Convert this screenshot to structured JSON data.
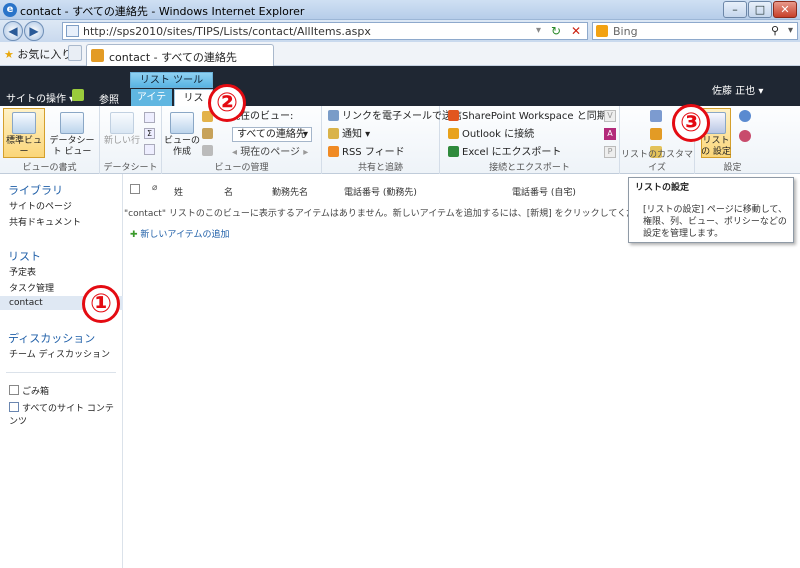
{
  "browser": {
    "title": "contact - すべての連絡先 - Windows Internet Explorer",
    "address": "http://sps2010/sites/TIPS/Lists/contact/AllItems.aspx",
    "search_engine": "Bing",
    "favorites_label": "お気に入り",
    "tab_label": "contact - すべての連絡先"
  },
  "sp": {
    "site_actions": "サイトの操作",
    "browse_tab": "参照",
    "context_group": "リスト ツール",
    "tab_items": "アイテム",
    "tab_list": "リスト",
    "user": "佐藤 正也"
  },
  "ribbon": {
    "standard_view": "標準ビュー",
    "datasheet_view": "データシート ビュー",
    "group_view_format": "ビューの書式",
    "new_row": "新しい行",
    "group_datasheet": "データシート",
    "create_view": "ビューの 作成",
    "current_view_label": "現在のビュー:",
    "current_view_value": "すべての連絡先",
    "current_page": "現在のページ",
    "group_manage_views": "ビューの管理",
    "email_link": "リンクを電子メールで送信",
    "alert_me": "通知",
    "rss_feed": "RSS フィード",
    "group_share_track": "共有と追跡",
    "sp_workspace": "SharePoint Workspace と同期",
    "connect_outlook": "Outlook に接続",
    "export_excel": "Excel にエクスポート",
    "group_connect_export": "接続とエクスポート",
    "group_customize": "リストのカスタマイズ",
    "list_settings": "リストの 設定",
    "group_settings": "設定"
  },
  "leftnav": {
    "libraries": "ライブラリ",
    "site_pages": "サイトのページ",
    "shared_docs": "共有ドキュメント",
    "lists": "リスト",
    "calendar": "予定表",
    "tasks": "タスク管理",
    "contact": "contact",
    "discussions": "ディスカッション",
    "team_discussion": "チーム ディスカッション",
    "recycle_bin": "ごみ箱",
    "all_content": "すべてのサイト コンテンツ"
  },
  "table": {
    "columns": [
      "姓",
      "名",
      "勤務先名",
      "電話番号 (勤務先)",
      "電話番号 (自宅)"
    ],
    "empty_message": "\"contact\" リストのこのビューに表示するアイテムはありません。新しいアイテムを追加するには、[新規] をクリックしてください。",
    "add_new": "新しいアイテムの追加"
  },
  "tooltip": {
    "title": "リストの設定",
    "body": "[リストの設定] ページに移動して、権限、列、ビュー、ポリシーなどの設定を管理します。"
  },
  "annotations": {
    "one": "①",
    "two": "②",
    "three": "③"
  }
}
